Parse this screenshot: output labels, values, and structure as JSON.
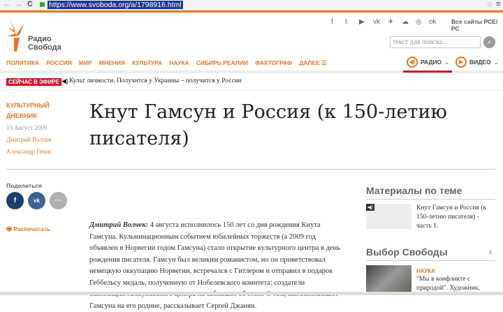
{
  "browser": {
    "url": "https://www.svoboda.org/a/1798916.html",
    "back": "←",
    "forward": "→",
    "reload": "C",
    "star": "☆",
    "menu": "≡"
  },
  "header": {
    "logo_line1": "Радио",
    "logo_line2": "Свобода",
    "social": [
      "f",
      "t",
      "▶",
      "vk",
      "✈",
      "☁",
      "◎",
      "ok"
    ],
    "all_sites": "Все сайты РСЕ/РС",
    "search_placeholder": "текст для поиска...",
    "search_icon": "search-icon"
  },
  "nav": {
    "items": [
      "ПОЛИТИКА",
      "РОССИЯ",
      "МИР",
      "МНЕНИЯ",
      "КУЛЬТУРА",
      "НАУКА",
      "СИБИРЬ.РЕАЛИИ",
      "ФАКТОГРАФ",
      "ДАЛЕЕ ☰"
    ],
    "radio": "РАДИО",
    "video": "ВИДЕО"
  },
  "live": {
    "badge": "СЕЙЧАС В ЭФИРЕ",
    "text": "Культ личности. Получится у Украины – получится у России"
  },
  "article": {
    "category": "КУЛЬТУРНЫЙ ДНЕВНИК",
    "date": "13 Август 2009",
    "authors": [
      "Дмитрий Волчек",
      "Александр Генис"
    ],
    "title": "Кнут Гамсун и Россия (к 150-летию писателя)",
    "share_label": "Поделиться",
    "print_label": "Распечатать",
    "lead_author": "Дмитрий Волчек:",
    "body": " 4 августа исполнилось 150 лет со дня рождения Кнута Гамсуна. Кульминационным событием юбилейных торжеств (а 2009 год объявлен в Норвегии годом Гамсуна) стало открытие культурного центра в день рождения писателя. Гамсун был великим романистом, но он приветствовал немецкую оккупацию Норвегии, встречался с Гитлером и отправил в подарок Геббельсу медаль, полученную от Нобелевского комитета: создатели экспозиции гамсуновского центра не забывают об этом. О том, как вспоминают Гамсуна на его родине, рассказывает Сергей Джанян."
  },
  "sidebar": {
    "related_title": "Материалы по теме",
    "related_item": "Кнут Гамсун и Россия (к 150-летию писателя) - часть 1.",
    "choice_title": "Выбор Свободы",
    "choice_category": "НАУКА",
    "choice_item": "\"Мы в конфликте с природой\". Художник,"
  },
  "colors": {
    "accent": "#e87722",
    "live": "#d6122a",
    "facebook": "#1b3f6e",
    "vk": "#3c6591",
    "more": "#b0b0b0"
  }
}
